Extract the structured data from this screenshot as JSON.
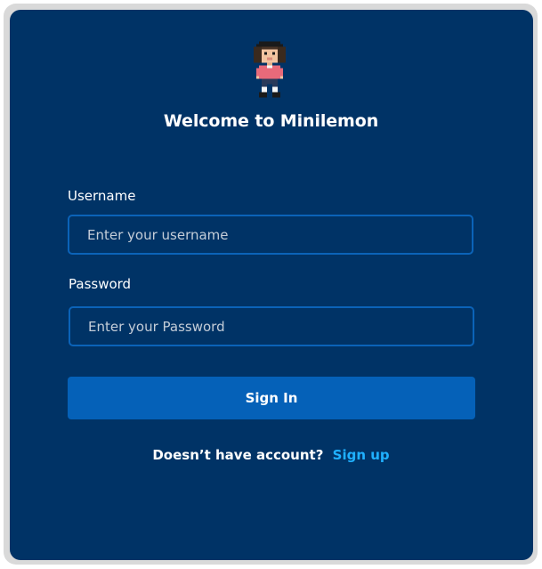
{
  "header": {
    "title": "Welcome to Minilemon",
    "avatar_icon": "pixel-character-avatar"
  },
  "form": {
    "username": {
      "label": "Username",
      "placeholder": "Enter your username",
      "value": ""
    },
    "password": {
      "label": "Password",
      "placeholder": "Enter your Password",
      "value": ""
    },
    "submit_label": "Sign In"
  },
  "footer": {
    "prompt": "Doesn’t have account?",
    "link_label": "Sign up"
  },
  "colors": {
    "card_background": "#003366",
    "frame": "#d9d9d9",
    "field_border": "#0b63b8",
    "button": "#0561b8",
    "link": "#1fb0ff",
    "text": "#ffffff"
  }
}
